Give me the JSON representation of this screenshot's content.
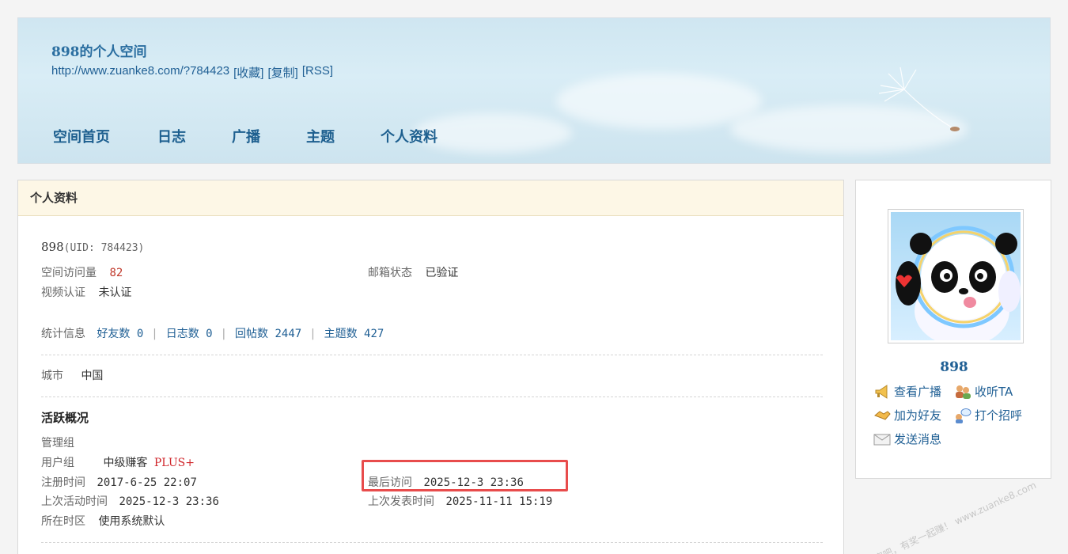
{
  "header": {
    "title": "898的个人空间",
    "url": "http://www.zuanke8.com/?784423",
    "links": [
      "[收藏]",
      "[复制]",
      "[RSS]"
    ],
    "nav": [
      "空间首页",
      "日志",
      "广播",
      "主题",
      "个人资料"
    ]
  },
  "profile": {
    "heading": "个人资料",
    "name": "898",
    "uid": "(UID: 784423)",
    "visits_label": "空间访问量",
    "visits_value": "82",
    "email_label": "邮箱状态",
    "email_value": "已验证",
    "video_label": "视频认证",
    "video_value": "未认证",
    "stats_label": "统计信息",
    "stats": [
      {
        "label": "好友数 0"
      },
      {
        "label": "日志数 0"
      },
      {
        "label": "回帖数 2447"
      },
      {
        "label": "主题数 427"
      }
    ],
    "city_label": "城市",
    "city_value": "中国",
    "activity_title": "活跃概况",
    "admin_group_label": "管理组",
    "user_group_label": "用户组",
    "user_group_value": "中级赚客",
    "user_group_plus": "PLUS+",
    "reg_label": "注册时间",
    "reg_value": "2017-6-25 22:07",
    "last_visit_label": "最后访问",
    "last_visit_value": "2025-12-3 23:36",
    "last_active_label": "上次活动时间",
    "last_active_value": "2025-12-3 23:36",
    "last_post_label": "上次发表时间",
    "last_post_value": "2025-11-11 15:19",
    "tz_label": "所在时区",
    "tz_value": "使用系统默认"
  },
  "sidebar": {
    "name": "898",
    "actions": [
      "查看广播",
      "收听TA",
      "加为好友",
      "打个招呼",
      "发送消息"
    ]
  },
  "watermark": "赚客吧，有奖一起赚！ www.zuanke8.com",
  "colors": {
    "link": "#1f5f94",
    "accent_red": "#c0392b",
    "highlight": "#e84c4c",
    "header_bg": "#fdf7e6"
  }
}
